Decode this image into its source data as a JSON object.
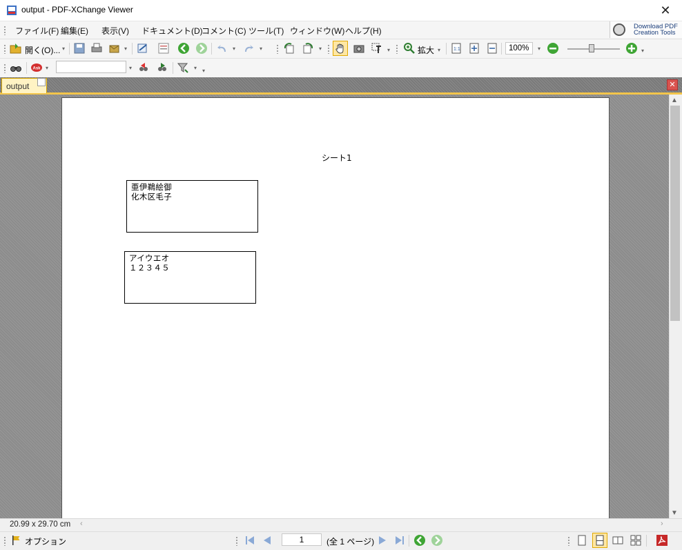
{
  "window": {
    "title": "output - PDF-XChange Viewer",
    "close": "✕"
  },
  "menu": {
    "items": [
      "ファイル(F)",
      "編集(E)",
      "表示(V)",
      "ドキュメント(D)",
      "コメント(C)",
      "ツール(T)",
      "ウィンドウ(W)",
      "ヘルプ(H)"
    ]
  },
  "promo": {
    "line1": "Download PDF",
    "line2": "Creation Tools"
  },
  "toolbar": {
    "open_label": "開く(O)...",
    "zoom_in_label": "拡大",
    "zoom_value": "100%"
  },
  "tab": {
    "label": "output"
  },
  "document": {
    "sheet_title": "シート1",
    "box1": {
      "line1": "亜伊鵜絵御",
      "line2": "化木区毛子"
    },
    "box2": {
      "line1": "アイウエオ",
      "line2": "１２３４５"
    }
  },
  "status": {
    "page_size": "20.99 x 29.70 cm",
    "options_label": "オプション",
    "page_number": "1",
    "page_count": "(全 1 ページ)"
  }
}
